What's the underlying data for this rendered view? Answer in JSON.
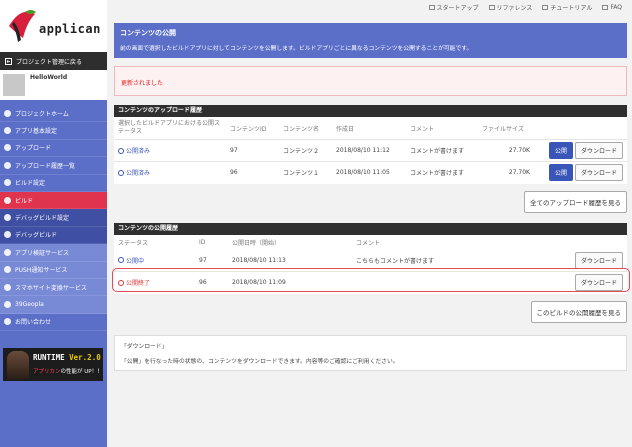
{
  "sidebar": {
    "logo": "applican",
    "back_label": "プロジェクト管理に戻る",
    "project_name": "HelloWorld",
    "items": [
      {
        "label": "プロジェクトホーム",
        "icon": "home-icon"
      },
      {
        "label": "アプリ基本設定",
        "icon": "gear-icon"
      },
      {
        "label": "アップロード",
        "icon": "upload-icon"
      },
      {
        "label": "アップロード履歴一覧",
        "icon": "list-icon"
      },
      {
        "label": "ビルド設定",
        "icon": "wrench-icon"
      },
      {
        "label": "ビルド",
        "icon": "build-icon"
      },
      {
        "label": "デバッグビルド設定",
        "icon": "debug-settings-icon"
      },
      {
        "label": "デバッグビルド",
        "icon": "debug-icon"
      },
      {
        "label": "アプリ検証サービス",
        "icon": "check-service-icon"
      },
      {
        "label": "PUSH通知サービス",
        "icon": "push-icon"
      },
      {
        "label": "スマホサイト変換サービス",
        "icon": "phone-icon"
      },
      {
        "label": "39Geopla",
        "icon": "geopla-icon"
      },
      {
        "label": "お問い合わせ",
        "icon": "mail-icon"
      }
    ],
    "banner_title": "RUNTIME ",
    "banner_version": "Ver.2.0",
    "banner_sub_highlight": "アプリカン",
    "banner_sub": "の性能が UP！！"
  },
  "toplinks": {
    "startup": "スタートアップ",
    "reference": "リファレンス",
    "tutorial": "チュートリアル",
    "faq": "FAQ"
  },
  "hero": {
    "title": "コンテンツの公開",
    "description": "前の画面で選択したビルドアプリに対してコンテンツを公開します。ビルドアプリごとに異なるコンテンツを公開することが可能です。"
  },
  "alert": "更新されました",
  "uploads": {
    "header": "コンテンツのアップロード履歴",
    "columns": [
      "選択したビルドアプリにおける公開ステータス",
      "コンテンツID",
      "コンテンツ名",
      "作成日",
      "コメント",
      "ファイルサイズ"
    ],
    "rows": [
      {
        "status": "公開済み",
        "id": "97",
        "name": "コンテンツ２",
        "date": "2018/08/10 11:12",
        "comment": "コメントが書けます",
        "size": "27.70K",
        "publish": "公開",
        "download": "ダウンロード"
      },
      {
        "status": "公開済み",
        "id": "96",
        "name": "コンテンツ１",
        "date": "2018/08/10 11:05",
        "comment": "コメントが書けます",
        "size": "27.70K",
        "publish": "公開",
        "download": "ダウンロード"
      }
    ],
    "more": "全てのアップロード履歴を見る"
  },
  "publish_history": {
    "header": "コンテンツの公開履歴",
    "columns": [
      "ステータス",
      "ID",
      "公開日時（開始）",
      "コメント"
    ],
    "rows": [
      {
        "status": "公開中",
        "id": "97",
        "date": "2018/08/10 11:13",
        "comment": "こちらもコメントが書けます",
        "download": "ダウンロード"
      },
      {
        "status": "公開終了",
        "id": "96",
        "date": "2018/08/10 11:09",
        "comment": "",
        "download": "ダウンロード"
      }
    ],
    "more": "このビルドの公開履歴を見る"
  },
  "note": {
    "title": "「ダウンロード」",
    "text": "「公開」を行なった時の状態の、コンテンツをダウンロードできます。内容等のご確認にご利用ください。"
  },
  "colors": {
    "accent": "#5b6fc9",
    "active": "#e0334e",
    "highlight": "#e24b5a"
  }
}
